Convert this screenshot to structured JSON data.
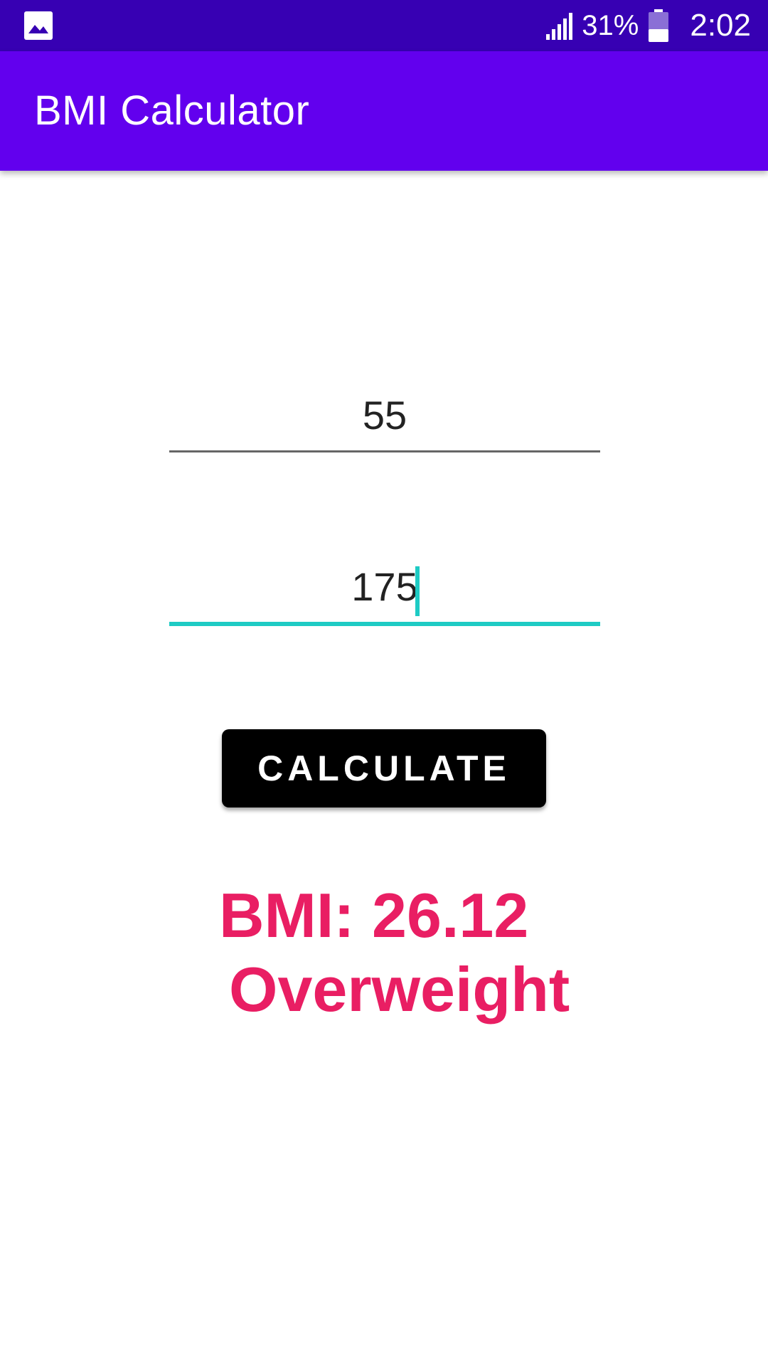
{
  "status_bar": {
    "left_icon": "image-icon",
    "signal_icon": "signal-icon",
    "battery_percent": "31%",
    "battery_icon": "battery-icon",
    "time": "2:02",
    "colors": {
      "background": "#3700B3"
    }
  },
  "app_bar": {
    "title": "BMI Calculator",
    "color": "#6200EE"
  },
  "form": {
    "weight_value": "55",
    "height_value": "175",
    "focus_color": "#1ECBC4"
  },
  "button": {
    "calculate_label": "CALCULATE"
  },
  "result": {
    "bmi_text": "BMI: 26.12",
    "category": "Overweight",
    "color": "#E91E63"
  }
}
